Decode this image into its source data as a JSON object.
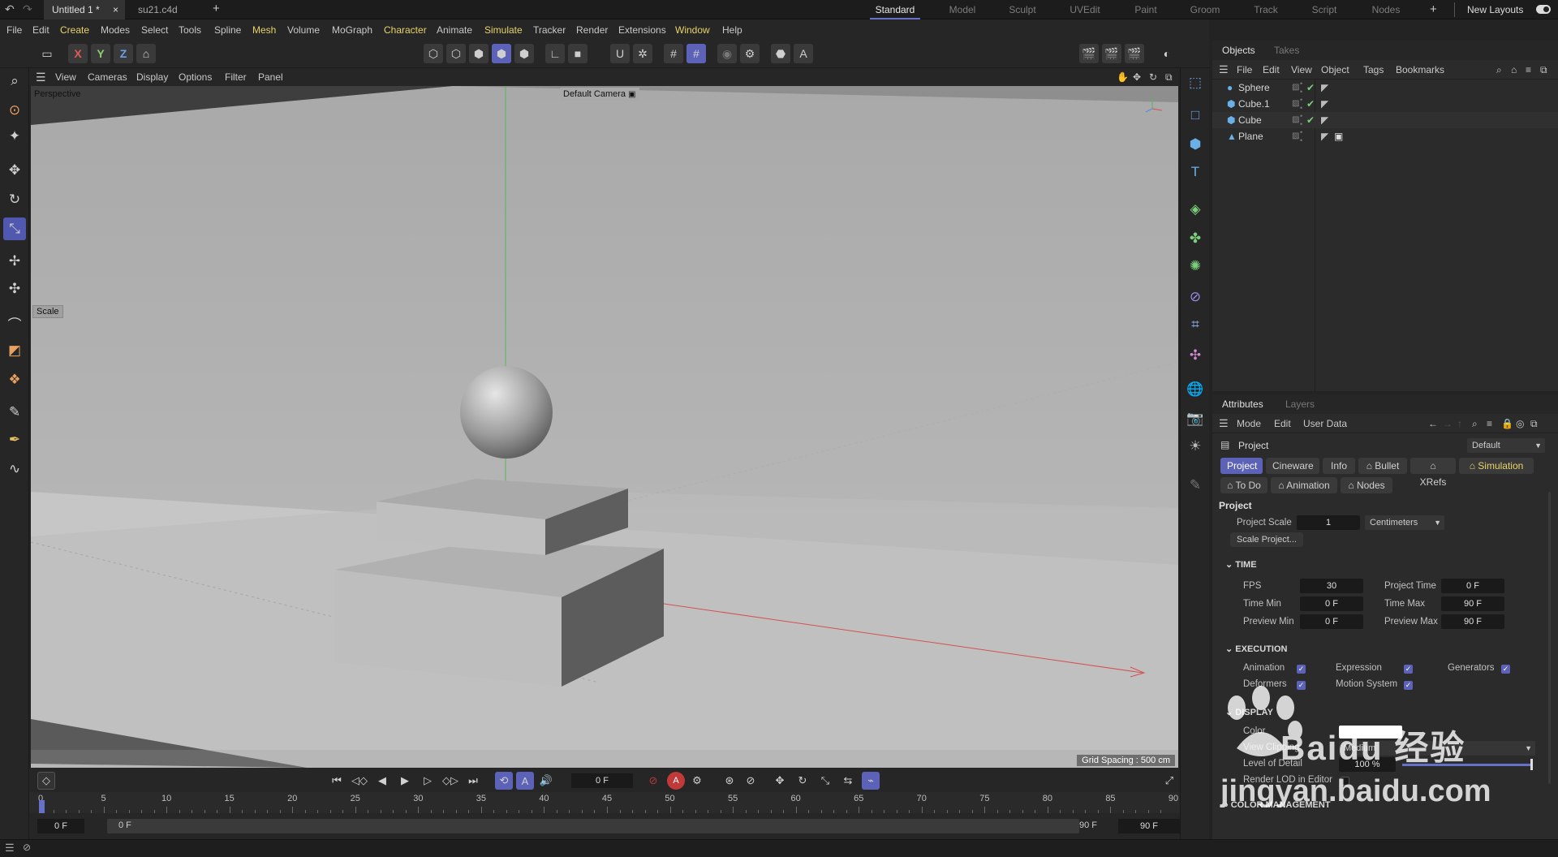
{
  "tabs": {
    "documents": [
      "Untitled 1 *",
      "su21.c4d"
    ],
    "new_tab": "+",
    "close": "×"
  },
  "layouts": {
    "items": [
      "Standard",
      "Model",
      "Sculpt",
      "UVEdit",
      "Paint",
      "Groom",
      "Track",
      "Script",
      "Nodes"
    ],
    "add": "+",
    "new_layouts": "New Layouts",
    "active": "Standard"
  },
  "menu": {
    "items": [
      "File",
      "Edit",
      "Create",
      "Modes",
      "Select",
      "Tools",
      "Spline",
      "Mesh",
      "Volume",
      "MoGraph",
      "Character",
      "Animate",
      "Simulate",
      "Tracker",
      "Render",
      "Extensions",
      "Window",
      "Help"
    ]
  },
  "toolbar": {
    "axis_x": "X",
    "axis_y": "Y",
    "axis_z": "Z"
  },
  "viewport": {
    "menu": [
      "View",
      "Cameras",
      "Display",
      "Options",
      "Filter",
      "Panel"
    ],
    "name": "Perspective",
    "camera": "Default Camera",
    "tool_hint": "Scale",
    "grid_spacing": "Grid Spacing : 500 cm"
  },
  "objects_panel": {
    "tabs": [
      "Objects",
      "Takes"
    ],
    "menu": [
      "File",
      "Edit",
      "View",
      "Object",
      "Tags",
      "Bookmarks"
    ],
    "objects": [
      {
        "name": "Sphere",
        "icon": "sphere-icon",
        "color": "#6ab0e6"
      },
      {
        "name": "Cube.1",
        "icon": "cube-icon",
        "color": "#6ab0e6"
      },
      {
        "name": "Cube",
        "icon": "cube-icon",
        "color": "#6ab0e6"
      },
      {
        "name": "Plane",
        "icon": "plane-icon",
        "color": "#6ab0e6"
      }
    ]
  },
  "attributes": {
    "tabs": [
      "Attributes",
      "Layers"
    ],
    "menu": [
      "Mode",
      "Edit",
      "User Data"
    ],
    "object": "Project",
    "preset": "Default",
    "chips_row1": [
      "Project",
      "Cineware",
      "Info",
      "Bullet",
      "XRefs",
      "Simulation"
    ],
    "chips_row2": [
      "To Do",
      "Animation",
      "Nodes"
    ],
    "section_title": "Project",
    "project_scale_label": "Project Scale",
    "project_scale_value": "1",
    "project_scale_unit": "Centimeters",
    "scale_project_button": "Scale Project...",
    "time_section": "TIME",
    "fps_label": "FPS",
    "fps": "30",
    "project_time_label": "Project Time",
    "project_time": "0 F",
    "time_min_label": "Time Min",
    "time_min": "0 F",
    "time_max_label": "Time Max",
    "time_max": "90 F",
    "preview_min_label": "Preview Min",
    "preview_min": "0 F",
    "preview_max_label": "Preview Max",
    "preview_max": "90 F",
    "execution_section": "EXECUTION",
    "exec": {
      "animation": "Animation",
      "expression": "Expression",
      "generators": "Generators",
      "deformers": "Deformers",
      "motion_system": "Motion System"
    },
    "display_section": "DISPLAY",
    "color_label": "Color",
    "view_clipping_label": "View Clipping",
    "view_clipping": "Medium",
    "lod_label": "Level of Detail",
    "lod": "100 %",
    "render_lod_label": "Render LOD in Editor",
    "color_mgmt_section": "COLOR MANAGEMENT"
  },
  "timeline": {
    "current_frame": "0 F",
    "ticks": [
      "0",
      "5",
      "10",
      "15",
      "20",
      "25",
      "30",
      "35",
      "40",
      "45",
      "50",
      "55",
      "60",
      "65",
      "70",
      "75",
      "80",
      "85",
      "90"
    ],
    "range_start": "0 F",
    "range_inner_start": "0 F",
    "range_inner_end": "90 F",
    "range_end": "90 F"
  },
  "watermark": {
    "text": "Baidu 经验",
    "url_text": "jingyan.baidu.com"
  }
}
